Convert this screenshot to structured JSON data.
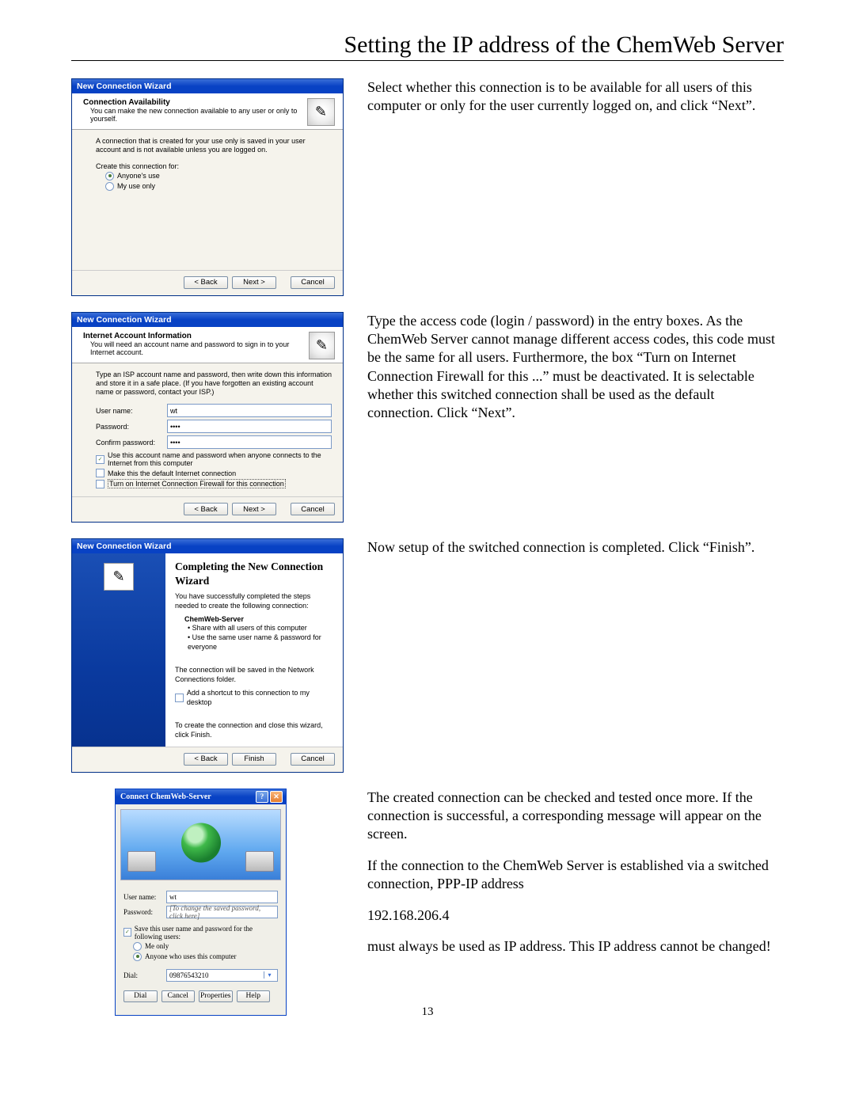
{
  "page_title": "Setting the IP address of the ChemWeb Server",
  "page_number": "13",
  "wiz_title": "New Connection Wizard",
  "nav": {
    "back": "< Back",
    "next": "Next >",
    "finish": "Finish",
    "cancel": "Cancel"
  },
  "icon_glyph": "✎",
  "s1": {
    "heading": "Connection Availability",
    "sub": "You can make the new connection available to any user or only to yourself.",
    "note": "A connection that is created for your use only is saved in your user account and is not available unless you are logged on.",
    "create_for": "Create this connection for:",
    "opt1": "Anyone's use",
    "opt2": "My use only",
    "desc": "Select whether this connection is to be available for all users of this computer or only for the user currently logged on, and click “Next”."
  },
  "s2": {
    "heading": "Internet Account Information",
    "sub": "You will need an account name and password to sign in to your Internet account.",
    "note": "Type an ISP account name and password, then write down this information and store it in a safe place. (If you have forgotten an existing account name or password, contact your ISP.)",
    "username_l": "User name:",
    "username_v": "wt",
    "password_l": "Password:",
    "password_v": "••••",
    "confirm_l": "Confirm password:",
    "confirm_v": "••••",
    "chk1": "Use this account name and password when anyone connects to the Internet from this computer",
    "chk2": "Make this the default Internet connection",
    "chk3": "Turn on Internet Connection Firewall for this connection",
    "desc": "Type the access code (login / password) in the entry boxes. As the ChemWeb Server cannot manage different access codes, this code must be the same for all users. Furthermore, the box “Turn on Internet Connection Firewall for this ...” must be deactivated. It is selectable whether this switched connection shall be used as the default connection. Click “Next”."
  },
  "s3": {
    "heading": "Completing the New Connection Wizard",
    "done": "You have successfully completed the steps needed to create the following connection:",
    "conn_name": "ChemWeb-Server",
    "b1": "Share with all users of this computer",
    "b2": "Use the same user name & password for everyone",
    "saved": "The connection will be saved in the Network Connections folder.",
    "shortcut": "Add a shortcut to this connection to my desktop",
    "close": "To create the connection and close this wizard, click Finish.",
    "desc": "Now setup of the switched connection is completed. Click “Finish”."
  },
  "s4": {
    "title": "Connect ChemWeb-Server",
    "username_l": "User name:",
    "username_v": "wt",
    "password_l": "Password:",
    "password_v": "[To change the saved password, click here]",
    "save": "Save this user name and password for the following users:",
    "opt1": "Me only",
    "opt2": "Anyone who uses this computer",
    "dial_l": "Dial:",
    "dial_v": "09876543210",
    "btns": {
      "dial": "Dial",
      "cancel": "Cancel",
      "props": "Properties",
      "help": "Help"
    },
    "desc_p1": "The created connection can be checked and tested once more. If the connection is successful, a corresponding message will appear on the screen.",
    "desc_p2": "If the connection to the ChemWeb Server is established via a switched connection, PPP-IP address",
    "ip": "192.168.206.4",
    "desc_p3": "must always be used as IP address. This IP address cannot be changed!"
  }
}
